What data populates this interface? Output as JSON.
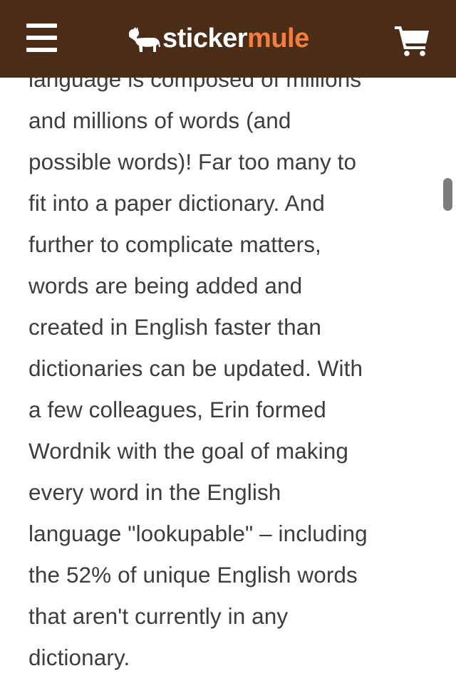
{
  "header": {
    "logo_sticker": "sticker",
    "logo_mule": "mule",
    "background_color": "#4b2c17",
    "logo_accent_color": "#f47e3e",
    "menu_icon": "hamburger-menu-icon",
    "cart_icon": "shopping-cart-icon",
    "logo_icon": "mule-icon"
  },
  "article": {
    "lines": [
      "language is composed of millions",
      "and millions of words (and",
      "possible words)! Far too many to",
      "fit into a paper dictionary. And",
      "further to complicate matters,",
      "words are being added and",
      "created in English faster than",
      "dictionaries can be updated. With",
      "a few colleagues, Erin formed",
      "Wordnik with the goal of making",
      "every word in the English",
      "language \"lookupable\" – including",
      "the 52% of unique English words",
      "that aren't currently in any",
      "dictionary."
    ]
  }
}
